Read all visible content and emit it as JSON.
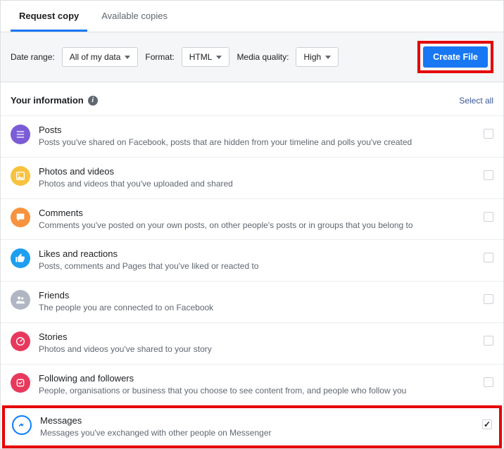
{
  "tabs": {
    "request": "Request copy",
    "available": "Available copies"
  },
  "options": {
    "dateRangeLabel": "Date range:",
    "dateRangeValue": "All of my data",
    "formatLabel": "Format:",
    "formatValue": "HTML",
    "mediaLabel": "Media quality:",
    "mediaValue": "High",
    "createBtn": "Create File"
  },
  "section": {
    "title": "Your information",
    "selectAll": "Select all"
  },
  "items": [
    {
      "title": "Posts",
      "desc": "Posts you've shared on Facebook, posts that are hidden from your timeline and polls you've created",
      "color": "#7b5cd6",
      "checked": false
    },
    {
      "title": "Photos and videos",
      "desc": "Photos and videos that you've uploaded and shared",
      "color": "#f7c23e",
      "checked": false
    },
    {
      "title": "Comments",
      "desc": "Comments you've posted on your own posts, on other people's posts or in groups that you belong to",
      "color": "#f7923e",
      "checked": false
    },
    {
      "title": "Likes and reactions",
      "desc": "Posts, comments and Pages that you've liked or reacted to",
      "color": "#1e9ef0",
      "checked": false
    },
    {
      "title": "Friends",
      "desc": "The people you are connected to on Facebook",
      "color": "#b0b7c3",
      "checked": false
    },
    {
      "title": "Stories",
      "desc": "Photos and videos you've shared to your story",
      "color": "#e8395d",
      "checked": false
    },
    {
      "title": "Following and followers",
      "desc": "People, organisations or business that you choose to see content from, and people who follow you",
      "color": "#e8395d",
      "checked": false
    },
    {
      "title": "Messages",
      "desc": "Messages you've exchanged with other people on Messenger",
      "color": "#0a7cff",
      "checked": true
    }
  ],
  "icons": {
    "posts": "list",
    "photos": "image",
    "comments": "bubble",
    "likes": "thumb",
    "friends": "people",
    "stories": "gauge",
    "following": "heart",
    "messages": "bolt"
  }
}
